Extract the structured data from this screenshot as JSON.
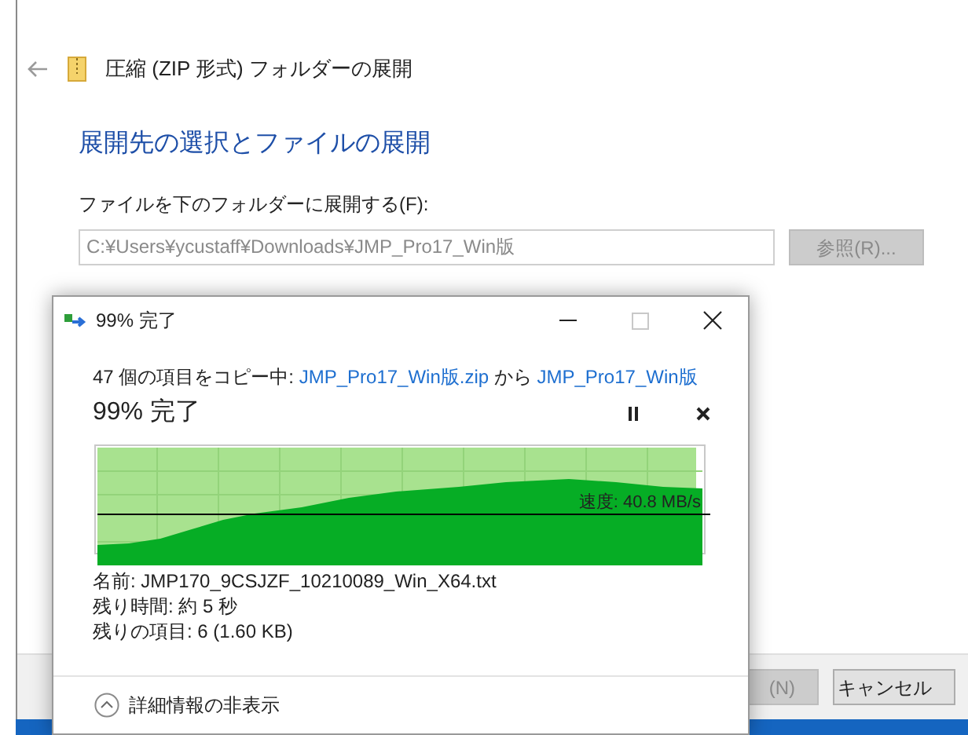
{
  "wizard": {
    "title": "圧縮 (ZIP 形式) フォルダーの展開",
    "heading": "展開先の選択とファイルの展開",
    "field_label": "ファイルを下のフォルダーに展開する(F):",
    "path": "C:¥Users¥ycustaff¥Downloads¥JMP_Pro17_Win版",
    "browse": {
      "label": "参照(R)...",
      "disabled": true
    },
    "buttons": [
      {
        "label": "(N)",
        "disabled": true
      },
      {
        "label": "キャンセル",
        "disabled": false
      }
    ]
  },
  "dialog": {
    "title": "99% 完了",
    "window_buttons": [
      {
        "kind": "minimize",
        "disabled": false
      },
      {
        "kind": "maximize",
        "disabled": true
      },
      {
        "kind": "close",
        "disabled": false
      }
    ],
    "message": {
      "prefix": "47 個の項目をコピー中: ",
      "source": "JMP_Pro17_Win版.zip",
      "middle": " から ",
      "target": "JMP_Pro17_Win版"
    },
    "progress_text": "99% 完了",
    "level": 0.99,
    "speed": "速度: 40.8 MB/s",
    "details": [
      "名前: JMP170_9CSJZF_10210089_Win_X64.txt",
      "残り時間: 約 5 秒",
      "残りの項目: 6 (1.60 KB)"
    ],
    "expander": "詳細情報の非表示"
  }
}
